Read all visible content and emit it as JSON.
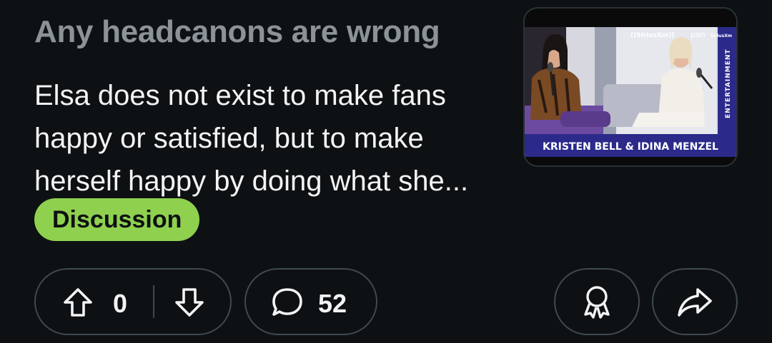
{
  "post": {
    "title": "Any headcanons are wrong",
    "body": "Elsa does not exist to make fans happy or satisfied, but to make herself happy by doing what she...",
    "flair": "Discussion"
  },
  "thumbnail": {
    "caption": "KRISTEN BELL & IDINA MENZEL",
    "side_label": "ENTERTAINMENT",
    "brand_left": "((SiriusXm))",
    "brand_right": "SiriusXm",
    "brand_mid": "pan"
  },
  "actions": {
    "votes": "0",
    "comments": "52"
  },
  "colors": {
    "background": "#0e1113",
    "title": "#8b9398",
    "flair_bg": "#8fd14f",
    "pill_border": "#3e4a52",
    "thumb_banner": "#2b2a8a"
  },
  "icons": [
    "upvote-icon",
    "downvote-icon",
    "comment-icon",
    "award-icon",
    "share-icon"
  ]
}
